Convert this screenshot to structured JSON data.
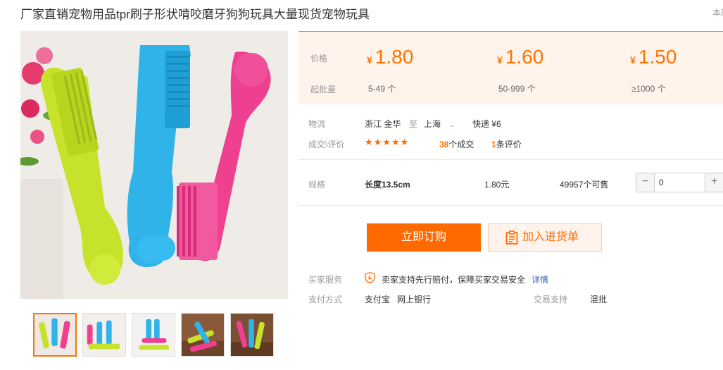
{
  "title": "厂家直销宠物用品tpr刷子形状啃咬磨牙狗狗玩具大量现货宠物玩具",
  "title_right": "本店",
  "price_panel": {
    "price_label": "价格",
    "qty_label": "起批量",
    "currency": "¥",
    "tiers": [
      {
        "price": "1.80",
        "qty": "5-49 个"
      },
      {
        "price": "1.60",
        "qty": "50-999 个"
      },
      {
        "price": "1.50",
        "qty": "≥1000 个"
      }
    ]
  },
  "logistics": {
    "label": "物流",
    "origin": "浙江 金华",
    "to_word": "至",
    "destination": "上海",
    "shipping": "快递 ¥6"
  },
  "deals": {
    "label": "成交\\评价",
    "stars": "★★★★★",
    "deal_count": "38",
    "deal_unit": "个成交",
    "review_count": "1",
    "review_unit": "条评价"
  },
  "spec": {
    "label": "规格",
    "name": "长度13.5cm",
    "price": "1.80元",
    "stock": "49957个可售",
    "quantity": "0",
    "minus": "−",
    "plus": "+"
  },
  "actions": {
    "buy_now": "立即订购",
    "add_to_list": "加入进货单"
  },
  "service": {
    "label": "买家服务",
    "text": "卖家支持先行赔付，保障买家交易安全",
    "details_link": "详情"
  },
  "payment": {
    "label": "支付方式",
    "methods": [
      "支付宝",
      "网上银行"
    ],
    "trade_label": "交易支持",
    "trade_value": "混批"
  },
  "colors": {
    "accent": "#ff6a00",
    "price_bg": "#fff3eb",
    "toy_green": "#c6e22a",
    "toy_blue": "#2fb3e8",
    "toy_pink": "#ef3f8f"
  }
}
